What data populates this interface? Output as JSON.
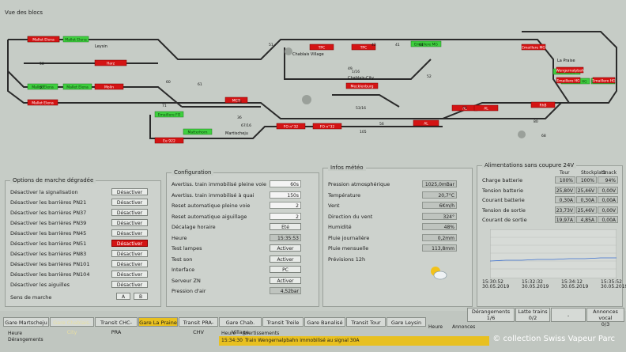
{
  "window_title": "Vue des blocs",
  "track": {
    "blocks_green": [
      {
        "label": "Mallet Elena"
      },
      {
        "label": "Mallet Elena"
      },
      {
        "label": "Mallet Elena"
      },
      {
        "label": "Mallet Elena"
      },
      {
        "label": "Emaillere FO"
      },
      {
        "label": "Matterhorn"
      },
      {
        "label": "Emaillere MG"
      },
      {
        "label": "Emaillere"
      },
      {
        "label": "Emaillere HG"
      },
      {
        "label": "Emaillere HG"
      }
    ],
    "blocks_red": [
      {
        "label": "Mallet Elena"
      },
      {
        "label": "Harz"
      },
      {
        "label": "Molin"
      },
      {
        "label": "Mallet Elena"
      },
      {
        "label": "MGB"
      },
      {
        "label": "TPC"
      },
      {
        "label": "TPC"
      },
      {
        "label": "Mecklenburg"
      },
      {
        "label": "FO n°32"
      },
      {
        "label": "FO n°32"
      },
      {
        "label": "AL"
      },
      {
        "label": "AL"
      },
      {
        "label": "AL"
      },
      {
        "label": "RhB"
      },
      {
        "label": "Wengernalpbah"
      },
      {
        "label": "Emaillere HG"
      },
      {
        "label": "Emaillere HG"
      },
      {
        "label": "Emaillere MG"
      },
      {
        "label": "Ee 922"
      }
    ],
    "station_labels": [
      {
        "label": "Leysin"
      },
      {
        "label": "Chablais Village"
      },
      {
        "label": "Chablais-City"
      },
      {
        "label": "La Praise"
      },
      {
        "label": "Martischeju"
      }
    ],
    "numbers": [
      "58",
      "57",
      "60",
      "61",
      "71",
      "41",
      "42",
      "61",
      "51",
      "49",
      "52",
      "1/16",
      "53/16",
      "56",
      "53",
      "67/16",
      "105",
      "36",
      "79",
      "80",
      "68"
    ]
  },
  "degraded": {
    "title": "Options de marche dégradée",
    "rows": [
      {
        "label": "Désactiver la signalisation",
        "button": "Désactiver",
        "active": false
      },
      {
        "label": "Désactiver les barrières PN21",
        "button": "Désactiver",
        "active": false
      },
      {
        "label": "Désactiver les barrières PN37",
        "button": "Désactiver",
        "active": false
      },
      {
        "label": "Désactiver les barrières PN39",
        "button": "Désactiver",
        "active": false
      },
      {
        "label": "Désactiver les barrières PN45",
        "button": "Désactiver",
        "active": false
      },
      {
        "label": "Désactiver les barrières PN51",
        "button": "Désactiver",
        "active": true
      },
      {
        "label": "Désactiver les barrières PN83",
        "button": "Désactiver",
        "active": false
      },
      {
        "label": "Désactiver les barrières PN101",
        "button": "Désactiver",
        "active": false
      },
      {
        "label": "Désactiver les barrières PN104",
        "button": "Désactiver",
        "active": false
      },
      {
        "label": "Désactiver les aiguilles",
        "button": "Désactiver",
        "active": false
      }
    ],
    "sens_label": "Sens de marche",
    "sens_a": "A",
    "sens_b": "B"
  },
  "config": {
    "title": "Configuration",
    "rows": [
      {
        "label": "Avertiss. train immobilisé pleine voie",
        "value": "60s",
        "kind": "white"
      },
      {
        "label": "Avertiss. train immobilisé à quai",
        "value": "150s",
        "kind": "white"
      },
      {
        "label": "Reset automatique pleine voie",
        "value": "2",
        "kind": "white"
      },
      {
        "label": "Reset automatique aiguillage",
        "value": "2",
        "kind": "white"
      },
      {
        "label": "Décalage horaire",
        "value": "Eté",
        "kind": "button"
      },
      {
        "label": "Heure",
        "value": "15:35:53",
        "kind": "grey"
      },
      {
        "label": "Test lampes",
        "value": "Activer",
        "kind": "button"
      },
      {
        "label": "Test son",
        "value": "Activer",
        "kind": "button"
      },
      {
        "label": "Interface",
        "value": "PC",
        "kind": "button"
      },
      {
        "label": "Serveur ZN",
        "value": "Activer",
        "kind": "button"
      },
      {
        "label": "Pression d'air",
        "value": "4,52bar",
        "kind": "grey"
      }
    ]
  },
  "meteo": {
    "title": "Infos météo",
    "rows": [
      {
        "label": "Pression atmosphérique",
        "value": "1025,0mBar"
      },
      {
        "label": "Température",
        "value": "20,7°C"
      },
      {
        "label": "Vent",
        "value": "6Km/h"
      },
      {
        "label": "Direction du vent",
        "value": "324°"
      },
      {
        "label": "Humidité",
        "value": "48%"
      },
      {
        "label": "Pluie journalière",
        "value": "0,2mm"
      },
      {
        "label": "Pluie mensuelle",
        "value": "113,8mm"
      },
      {
        "label": "Prévisions 12h",
        "value": ""
      }
    ]
  },
  "power": {
    "title": "Alimentations sans coupure 24V",
    "columns": [
      "Tour",
      "Stockplatz",
      "Snack"
    ],
    "rows": [
      {
        "label": "Charge batterie",
        "values": [
          "100%",
          "100%",
          "94%"
        ]
      },
      {
        "label": "Tension batterie",
        "values": [
          "25,80V",
          "25,46V",
          "0,00V"
        ]
      },
      {
        "label": "Courant batterie",
        "values": [
          "0,30A",
          "0,30A",
          "0,00A"
        ]
      },
      {
        "label": "Tension de sortie",
        "values": [
          "23,73V",
          "25,46V",
          "0,00V"
        ]
      },
      {
        "label": "Courant de sortie",
        "values": [
          "19,97A",
          "4,85A",
          "0,00A"
        ]
      }
    ],
    "chart_times": [
      {
        "time": "15:30:52",
        "date": "30.05.2019"
      },
      {
        "time": "15:32:32",
        "date": "30.05.2019"
      },
      {
        "time": "15:34:12",
        "date": "30.05.2019"
      },
      {
        "time": "15:35:52",
        "date": "30.05.2019"
      }
    ]
  },
  "tabs": [
    {
      "label": "Gare Martscheju",
      "state": "normal"
    },
    {
      "label": "Gare Chablais-City",
      "state": "dim"
    },
    {
      "label": "Transit CHC-PRA",
      "state": "normal"
    },
    {
      "label": "Gare La Praine",
      "state": "active"
    },
    {
      "label": "Transit PRA-CHV",
      "state": "normal"
    },
    {
      "label": "Gare Chab. Village",
      "state": "normal"
    },
    {
      "label": "Transit Treile",
      "state": "normal"
    },
    {
      "label": "Gare Banalisé",
      "state": "normal"
    },
    {
      "label": "Transit Tour",
      "state": "normal"
    },
    {
      "label": "Gare Leysin",
      "state": "normal"
    }
  ],
  "counters": {
    "derangements_label": "Dérangements",
    "derangements_value": "1/6",
    "trains_label": "Latte trains",
    "trains_value": "0/2",
    "dash": "-",
    "annonces_label": "Annonces vocal",
    "annonces_value": "0/3"
  },
  "bottom": {
    "heure_left": "Heure",
    "derangements_left": "Dérangements",
    "heure_mid": "Heure",
    "avert_mid": "Avertissements",
    "alarm_time": "15:34:30",
    "alarm_text": "Train Wengernalpbahn immobilisé au signal 30A",
    "heure_right": "Heure",
    "annonces_right": "Annonces"
  },
  "watermark": "© collection Swiss Vapeur Parc",
  "colors": {
    "screen": "#c6ccc6",
    "red_block": "#d41414",
    "green_block": "#3fcf3f",
    "track": "#2a2a2a",
    "tab_active": "#e8c020"
  }
}
